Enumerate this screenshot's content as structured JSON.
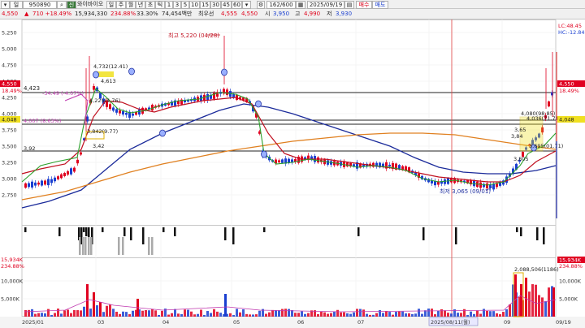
{
  "toolbar1": {
    "code": "950890",
    "name": "와이바이오",
    "periods": [
      "주",
      "월",
      "년",
      "초",
      "틱"
    ],
    "minutes": [
      "1",
      "3",
      "5",
      "10",
      "15",
      "30",
      "45",
      "60"
    ],
    "count": "162/600",
    "date": "2025/09/19",
    "period_selected": "일",
    "buy": "매수",
    "sell": "매도"
  },
  "toolbar2": {
    "price": "4,550",
    "change": "710 +18.49%",
    "volume": "15,934,330",
    "volume_pct": "234.88%",
    "turnover": "33.30%",
    "amount": "74,454백만",
    "pref_label": "최우선",
    "pref1": "4,555",
    "pref2": "4,550",
    "open_label": "시",
    "open": "3,950",
    "high_label": "고",
    "high": "4,990",
    "low_label": "저",
    "low": "3,930"
  },
  "price_axis": [
    "5,250",
    "5,000",
    "4,750",
    "4,500",
    "4,250",
    "4,000",
    "3,750",
    "3,500",
    "3,250",
    "3,000",
    "2,750"
  ],
  "volume_axis": [
    "10,000K",
    "5,000K"
  ],
  "x_axis": [
    "2025/01",
    "03",
    "04",
    "05",
    "06",
    "07",
    "2025/08/11(월)",
    "09",
    "09/19"
  ],
  "right_badges": {
    "lc": "LC:48.45",
    "hc": "HC:-12.84",
    "current": "4,550",
    "current_pct": "18.49%",
    "ma_value": "4,048",
    "vol": "15,934K",
    "vol_pct": "234.88%"
  },
  "left_badges": {
    "current": "4,550",
    "current_pct": "18.49%",
    "ma_value": "4,048",
    "vol": "15,934K",
    "vol_pct": "234.88%"
  },
  "annotations": {
    "high": "최고 5,220 (04/28)",
    "low": "최저 3,065 (09/01)",
    "v4423": "4,423",
    "a1": "-34.49 (-4.07%)",
    "a2": "4,007 (8.63%)",
    "a3": "3,92",
    "a4": "4,732(12.41)",
    "a5": "4,613",
    "a6": "4,225(4.76)",
    "a7": "3,842(9.77)",
    "a8": "3,42",
    "a9": "4,080(98.85)",
    "a10": "4,036(71.71)",
    "a11": "3,65",
    "a12": "3,84",
    "a13": "3,805",
    "a14": "3,695(01.71)",
    "vol_ann": "2,088,506(1186)"
  },
  "colors": {
    "up": "#e00020",
    "down": "#1a3fd0",
    "ma5": "#2aa02a",
    "ma20": "#c01020",
    "ma60": "#1a2a9a",
    "ma120": "#e08020",
    "highlight": "#f0e020"
  }
}
